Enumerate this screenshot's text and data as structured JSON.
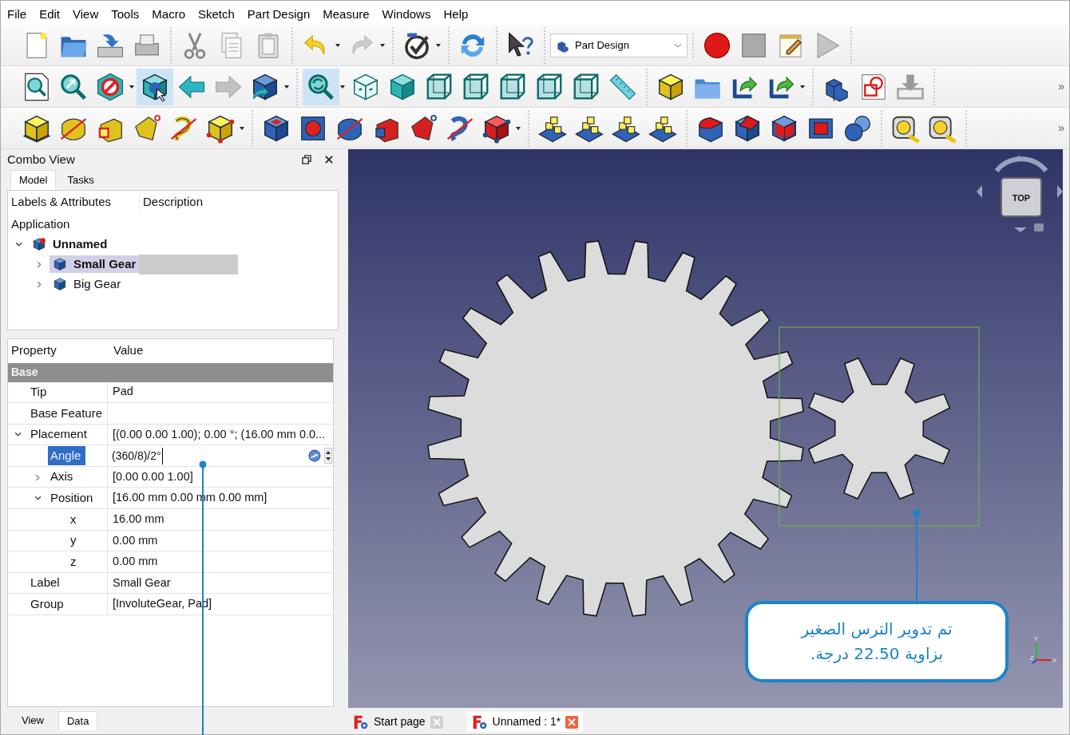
{
  "menu": [
    "File",
    "Edit",
    "View",
    "Tools",
    "Macro",
    "Sketch",
    "Part Design",
    "Measure",
    "Windows",
    "Help"
  ],
  "toolbar_rows": [
    {
      "groups": [
        {
          "items": [
            {
              "kind": "newdoc",
              "pressed": false
            },
            {
              "kind": "open",
              "pressed": false
            },
            {
              "kind": "save",
              "pressed": false
            },
            {
              "kind": "print",
              "pressed": false
            }
          ]
        },
        {
          "items": [
            {
              "kind": "cut",
              "pressed": false
            },
            {
              "kind": "copy",
              "pressed": false
            },
            {
              "kind": "paste",
              "pressed": false
            }
          ]
        },
        {
          "items": [
            {
              "kind": "undo",
              "pressed": false
            },
            {
              "kind": "caret"
            },
            {
              "kind": "redo",
              "pressed": false
            },
            {
              "kind": "caret"
            }
          ]
        },
        {
          "items": [
            {
              "kind": "validate",
              "pressed": false
            },
            {
              "kind": "caret"
            }
          ]
        },
        {
          "items": [
            {
              "kind": "refresh",
              "pressed": false
            }
          ]
        },
        {
          "items": [
            {
              "kind": "whatsthis",
              "pressed": false
            }
          ]
        },
        {
          "combo": "Part Design"
        },
        {
          "items": [
            {
              "kind": "record",
              "pressed": false
            },
            {
              "kind": "stop",
              "pressed": false
            },
            {
              "kind": "macro",
              "pressed": false
            },
            {
              "kind": "play",
              "pressed": false
            }
          ]
        }
      ]
    },
    {
      "overflow": "»",
      "groups": [
        {
          "items": [
            {
              "kind": "fitall",
              "pressed": false
            },
            {
              "kind": "fitsel",
              "pressed": false
            },
            {
              "kind": "noentry",
              "pressed": false
            },
            {
              "kind": "caret"
            },
            {
              "kind": "boxsel",
              "pressed": true
            },
            {
              "kind": "back",
              "pressed": false
            },
            {
              "kind": "forward",
              "pressed": false
            },
            {
              "kind": "stdview",
              "pressed": false
            },
            {
              "kind": "caret"
            }
          ]
        },
        {
          "items": [
            {
              "kind": "syncview",
              "pressed": true
            },
            {
              "kind": "caret"
            },
            {
              "kind": "isoview",
              "pressed": false
            },
            {
              "kind": "solidview",
              "pressed": false
            },
            {
              "kind": "wireview",
              "pressed": false
            },
            {
              "kind": "wireview",
              "pressed": false
            },
            {
              "kind": "wireview",
              "pressed": false
            },
            {
              "kind": "wireview",
              "pressed": false
            },
            {
              "kind": "wireview",
              "pressed": false
            },
            {
              "kind": "ruler",
              "pressed": false
            }
          ]
        },
        {
          "items": [
            {
              "kind": "part",
              "pressed": false
            },
            {
              "kind": "group",
              "pressed": false
            },
            {
              "kind": "link",
              "pressed": false
            },
            {
              "kind": "link",
              "pressed": false
            },
            {
              "kind": "caret"
            }
          ]
        },
        {
          "items": [
            {
              "kind": "body",
              "pressed": false
            },
            {
              "kind": "sketch",
              "pressed": false
            },
            {
              "kind": "import",
              "pressed": false
            }
          ]
        }
      ]
    },
    {
      "overflow": "»",
      "groups": [
        {
          "items": [
            {
              "kind": "pad",
              "pressed": false
            },
            {
              "kind": "revolve",
              "pressed": false
            },
            {
              "kind": "loft",
              "pressed": false
            },
            {
              "kind": "pipe",
              "pressed": false
            },
            {
              "kind": "helix",
              "pressed": false
            },
            {
              "kind": "primitive",
              "pressed": false
            },
            {
              "kind": "caret"
            }
          ]
        },
        {
          "items": [
            {
              "kind": "pocket",
              "pressed": false
            },
            {
              "kind": "hole",
              "pressed": false
            },
            {
              "kind": "groove",
              "pressed": false
            },
            {
              "kind": "subloft",
              "pressed": false
            },
            {
              "kind": "subpipe",
              "pressed": false
            },
            {
              "kind": "subhelix",
              "pressed": false
            },
            {
              "kind": "subprimitive",
              "pressed": false
            },
            {
              "kind": "caret"
            }
          ]
        },
        {
          "items": [
            {
              "kind": "pattern",
              "pressed": false
            },
            {
              "kind": "pattern",
              "pressed": false
            },
            {
              "kind": "pattern",
              "pressed": false
            },
            {
              "kind": "pattern",
              "pressed": false
            }
          ]
        },
        {
          "items": [
            {
              "kind": "fillet",
              "pressed": false
            },
            {
              "kind": "chamfer",
              "pressed": false
            },
            {
              "kind": "draft",
              "pressed": false
            },
            {
              "kind": "thickness",
              "pressed": false
            },
            {
              "kind": "boolean",
              "pressed": false
            }
          ]
        },
        {
          "items": [
            {
              "kind": "tape",
              "pressed": false
            },
            {
              "kind": "tape",
              "pressed": false
            }
          ]
        }
      ]
    }
  ],
  "combo_view": {
    "title": "Combo View",
    "tabs": [
      {
        "label": "Model",
        "selected": true
      },
      {
        "label": "Tasks",
        "selected": false
      }
    ],
    "tree": {
      "columns": [
        "Labels & Attributes",
        "Description"
      ],
      "root": "Application",
      "items": [
        {
          "label": "Unnamed",
          "active": true,
          "selected": false,
          "expanded": true,
          "children": [
            {
              "label": "Small Gear",
              "active": true,
              "selected": true,
              "expanded": false
            },
            {
              "label": "Big Gear",
              "active": false,
              "selected": false,
              "expanded": false
            }
          ]
        }
      ]
    },
    "properties": {
      "columns": [
        "Property",
        "Value"
      ],
      "group": "Base",
      "rows": [
        {
          "name": "Tip",
          "value": "Pad",
          "selected": false
        },
        {
          "name": "Base Feature",
          "selected": false
        },
        {
          "name": "Placement",
          "value": "[(0.00 0.00 1.00); 0.00 °; (16.00 mm  0.0...",
          "selected": false,
          "expanded": true,
          "children": [
            {
              "name": "Angle",
              "value": "(360/8)/2°",
              "selected": true,
              "editing": true
            },
            {
              "name": "Axis",
              "value": "[0.00 0.00 1.00]",
              "selected": false,
              "expanded": false
            },
            {
              "name": "Position",
              "value": "[16.00 mm  0.00 mm  0.00 mm]",
              "selected": false,
              "expanded": true,
              "children": [
                {
                  "name": "x",
                  "value": "16.00 mm",
                  "selected": false
                },
                {
                  "name": "y",
                  "value": "0.00 mm",
                  "selected": false
                },
                {
                  "name": "z",
                  "value": "0.00 mm",
                  "selected": false
                }
              ]
            }
          ]
        },
        {
          "name": "Label",
          "value": "Small Gear",
          "selected": false
        },
        {
          "name": "Group",
          "value": "[InvoluteGear, Pad]",
          "selected": false
        }
      ]
    },
    "bottom_tabs": [
      {
        "label": "View",
        "selected": false
      },
      {
        "label": "Data",
        "selected": true
      }
    ]
  },
  "viewport": {
    "nav_cube_face": "TOP",
    "axis_labels": [
      "Y",
      "Z",
      "X"
    ]
  },
  "document_tabs": [
    {
      "label": "Start page",
      "selected": false
    },
    {
      "label": "Unnamed : 1*",
      "selected": true
    }
  ],
  "callout": {
    "text": "تم تدوير الترس الصغير\nبزاوية 22.50 درجة."
  }
}
